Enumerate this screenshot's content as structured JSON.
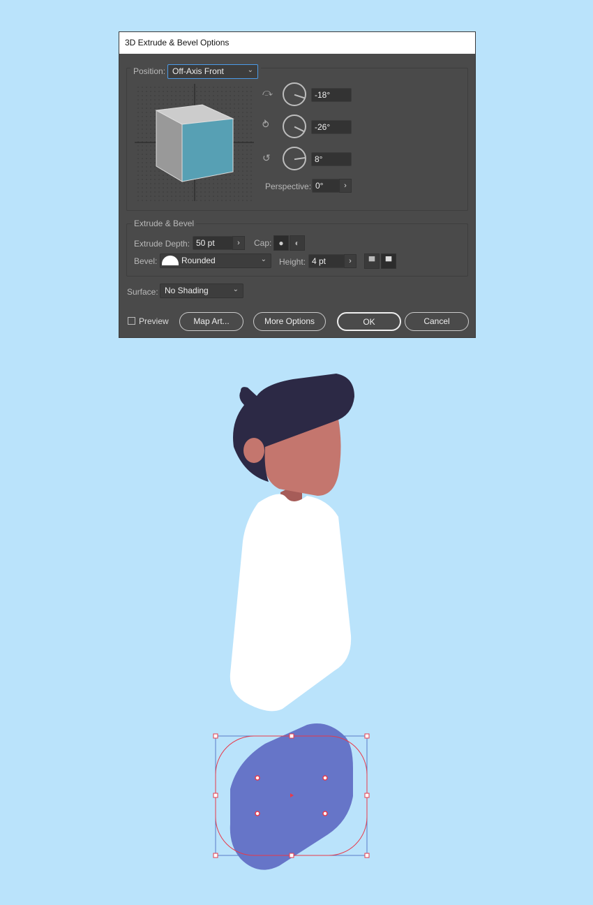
{
  "dialog": {
    "title": "3D Extrude & Bevel Options",
    "position": {
      "label": "Position:",
      "value": "Off-Axis Front"
    },
    "rotation": {
      "x": "-18°",
      "y": "-26°",
      "z": "8°"
    },
    "perspective": {
      "label": "Perspective:",
      "value": "0°"
    },
    "extrude_bevel": {
      "heading": "Extrude & Bevel",
      "depth_label": "Extrude Depth:",
      "depth": "50 pt",
      "cap_label": "Cap:",
      "bevel_label": "Bevel:",
      "bevel": "Rounded",
      "height_label": "Height:",
      "height": "4 pt"
    },
    "surface": {
      "label": "Surface:",
      "value": "No Shading"
    },
    "preview": {
      "label": "Preview",
      "checked": false
    },
    "buttons": {
      "map_art": "Map Art...",
      "more_options": "More Options",
      "ok": "OK",
      "cancel": "Cancel"
    }
  },
  "colors": {
    "hair": "#2c2945",
    "skin": "#c4766e",
    "neck": "#a65c58",
    "shirt": "#ffffff",
    "blob": "#6675c8",
    "selection": "#e8394a",
    "cube_front": "#57a0b4"
  }
}
